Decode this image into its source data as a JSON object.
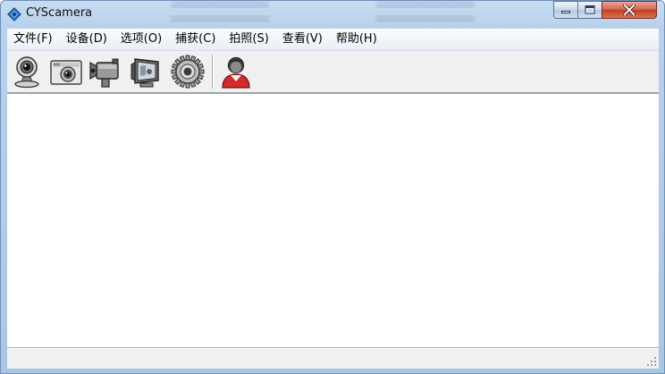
{
  "window": {
    "title": "CYScamera"
  },
  "menu": {
    "items": [
      {
        "label": "文件(F)"
      },
      {
        "label": "设备(D)"
      },
      {
        "label": "选项(O)"
      },
      {
        "label": "捕获(C)"
      },
      {
        "label": "拍照(S)"
      },
      {
        "label": "查看(V)"
      },
      {
        "label": "帮助(H)"
      }
    ]
  },
  "toolbar": {
    "icons": [
      "webcam-icon",
      "photo-camera-icon",
      "video-camera-icon",
      "monitor-icon",
      "settings-gear-icon",
      "user-icon"
    ]
  },
  "colors": {
    "titlebar": "#b8d1ec",
    "close_button": "#c23b22",
    "user_icon": "#d42a2a"
  }
}
